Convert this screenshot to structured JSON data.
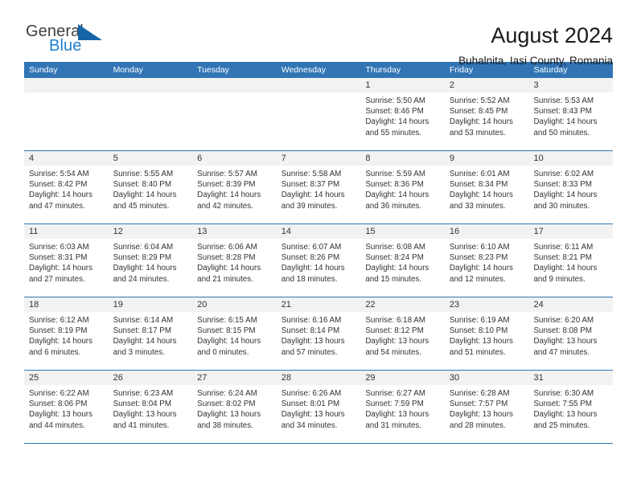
{
  "logo": {
    "word_top": "General",
    "word_bottom": "Blue",
    "triangle_icon": "blue-triangle-icon"
  },
  "header": {
    "title": "August 2024",
    "subtitle": "Buhalnita, Iasi County, Romania"
  },
  "colors": {
    "header_blue": "#3175b5",
    "date_band_gray": "#f2f2f2",
    "logo_blue": "#1f7fd0",
    "text": "#333333"
  },
  "day_names": [
    "Sunday",
    "Monday",
    "Tuesday",
    "Wednesday",
    "Thursday",
    "Friday",
    "Saturday"
  ],
  "weeks": [
    [
      {
        "day": "",
        "lines": []
      },
      {
        "day": "",
        "lines": []
      },
      {
        "day": "",
        "lines": []
      },
      {
        "day": "",
        "lines": []
      },
      {
        "day": "1",
        "lines": [
          "Sunrise: 5:50 AM",
          "Sunset: 8:46 PM",
          "Daylight: 14 hours",
          "and 55 minutes."
        ]
      },
      {
        "day": "2",
        "lines": [
          "Sunrise: 5:52 AM",
          "Sunset: 8:45 PM",
          "Daylight: 14 hours",
          "and 53 minutes."
        ]
      },
      {
        "day": "3",
        "lines": [
          "Sunrise: 5:53 AM",
          "Sunset: 8:43 PM",
          "Daylight: 14 hours",
          "and 50 minutes."
        ]
      }
    ],
    [
      {
        "day": "4",
        "lines": [
          "Sunrise: 5:54 AM",
          "Sunset: 8:42 PM",
          "Daylight: 14 hours",
          "and 47 minutes."
        ]
      },
      {
        "day": "5",
        "lines": [
          "Sunrise: 5:55 AM",
          "Sunset: 8:40 PM",
          "Daylight: 14 hours",
          "and 45 minutes."
        ]
      },
      {
        "day": "6",
        "lines": [
          "Sunrise: 5:57 AM",
          "Sunset: 8:39 PM",
          "Daylight: 14 hours",
          "and 42 minutes."
        ]
      },
      {
        "day": "7",
        "lines": [
          "Sunrise: 5:58 AM",
          "Sunset: 8:37 PM",
          "Daylight: 14 hours",
          "and 39 minutes."
        ]
      },
      {
        "day": "8",
        "lines": [
          "Sunrise: 5:59 AM",
          "Sunset: 8:36 PM",
          "Daylight: 14 hours",
          "and 36 minutes."
        ]
      },
      {
        "day": "9",
        "lines": [
          "Sunrise: 6:01 AM",
          "Sunset: 8:34 PM",
          "Daylight: 14 hours",
          "and 33 minutes."
        ]
      },
      {
        "day": "10",
        "lines": [
          "Sunrise: 6:02 AM",
          "Sunset: 8:33 PM",
          "Daylight: 14 hours",
          "and 30 minutes."
        ]
      }
    ],
    [
      {
        "day": "11",
        "lines": [
          "Sunrise: 6:03 AM",
          "Sunset: 8:31 PM",
          "Daylight: 14 hours",
          "and 27 minutes."
        ]
      },
      {
        "day": "12",
        "lines": [
          "Sunrise: 6:04 AM",
          "Sunset: 8:29 PM",
          "Daylight: 14 hours",
          "and 24 minutes."
        ]
      },
      {
        "day": "13",
        "lines": [
          "Sunrise: 6:06 AM",
          "Sunset: 8:28 PM",
          "Daylight: 14 hours",
          "and 21 minutes."
        ]
      },
      {
        "day": "14",
        "lines": [
          "Sunrise: 6:07 AM",
          "Sunset: 8:26 PM",
          "Daylight: 14 hours",
          "and 18 minutes."
        ]
      },
      {
        "day": "15",
        "lines": [
          "Sunrise: 6:08 AM",
          "Sunset: 8:24 PM",
          "Daylight: 14 hours",
          "and 15 minutes."
        ]
      },
      {
        "day": "16",
        "lines": [
          "Sunrise: 6:10 AM",
          "Sunset: 8:23 PM",
          "Daylight: 14 hours",
          "and 12 minutes."
        ]
      },
      {
        "day": "17",
        "lines": [
          "Sunrise: 6:11 AM",
          "Sunset: 8:21 PM",
          "Daylight: 14 hours",
          "and 9 minutes."
        ]
      }
    ],
    [
      {
        "day": "18",
        "lines": [
          "Sunrise: 6:12 AM",
          "Sunset: 8:19 PM",
          "Daylight: 14 hours",
          "and 6 minutes."
        ]
      },
      {
        "day": "19",
        "lines": [
          "Sunrise: 6:14 AM",
          "Sunset: 8:17 PM",
          "Daylight: 14 hours",
          "and 3 minutes."
        ]
      },
      {
        "day": "20",
        "lines": [
          "Sunrise: 6:15 AM",
          "Sunset: 8:15 PM",
          "Daylight: 14 hours",
          "and 0 minutes."
        ]
      },
      {
        "day": "21",
        "lines": [
          "Sunrise: 6:16 AM",
          "Sunset: 8:14 PM",
          "Daylight: 13 hours",
          "and 57 minutes."
        ]
      },
      {
        "day": "22",
        "lines": [
          "Sunrise: 6:18 AM",
          "Sunset: 8:12 PM",
          "Daylight: 13 hours",
          "and 54 minutes."
        ]
      },
      {
        "day": "23",
        "lines": [
          "Sunrise: 6:19 AM",
          "Sunset: 8:10 PM",
          "Daylight: 13 hours",
          "and 51 minutes."
        ]
      },
      {
        "day": "24",
        "lines": [
          "Sunrise: 6:20 AM",
          "Sunset: 8:08 PM",
          "Daylight: 13 hours",
          "and 47 minutes."
        ]
      }
    ],
    [
      {
        "day": "25",
        "lines": [
          "Sunrise: 6:22 AM",
          "Sunset: 8:06 PM",
          "Daylight: 13 hours",
          "and 44 minutes."
        ]
      },
      {
        "day": "26",
        "lines": [
          "Sunrise: 6:23 AM",
          "Sunset: 8:04 PM",
          "Daylight: 13 hours",
          "and 41 minutes."
        ]
      },
      {
        "day": "27",
        "lines": [
          "Sunrise: 6:24 AM",
          "Sunset: 8:02 PM",
          "Daylight: 13 hours",
          "and 38 minutes."
        ]
      },
      {
        "day": "28",
        "lines": [
          "Sunrise: 6:26 AM",
          "Sunset: 8:01 PM",
          "Daylight: 13 hours",
          "and 34 minutes."
        ]
      },
      {
        "day": "29",
        "lines": [
          "Sunrise: 6:27 AM",
          "Sunset: 7:59 PM",
          "Daylight: 13 hours",
          "and 31 minutes."
        ]
      },
      {
        "day": "30",
        "lines": [
          "Sunrise: 6:28 AM",
          "Sunset: 7:57 PM",
          "Daylight: 13 hours",
          "and 28 minutes."
        ]
      },
      {
        "day": "31",
        "lines": [
          "Sunrise: 6:30 AM",
          "Sunset: 7:55 PM",
          "Daylight: 13 hours",
          "and 25 minutes."
        ]
      }
    ]
  ]
}
